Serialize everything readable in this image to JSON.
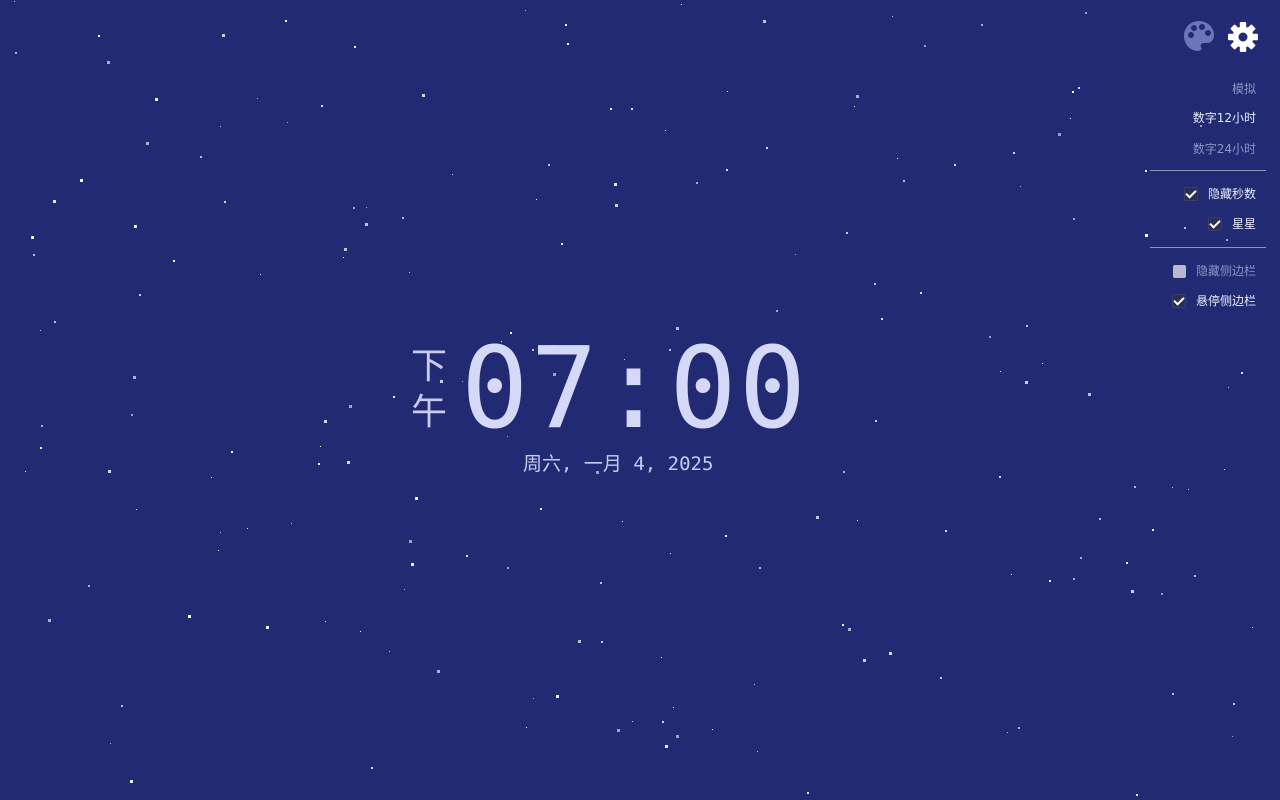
{
  "clock": {
    "period_top": "下",
    "period_bottom": "午",
    "time": "07:00",
    "date": "周六, 一月 4, 2025"
  },
  "top_icons": {
    "palette": "palette-icon",
    "settings": "gear-icon"
  },
  "menu": {
    "display_modes": [
      {
        "label": "模拟",
        "selected": false
      },
      {
        "label": "数字12小时",
        "selected": true
      },
      {
        "label": "数字24小时",
        "selected": false
      }
    ],
    "options_a": [
      {
        "label": "隐藏秒数",
        "checked": true
      },
      {
        "label": "星星",
        "checked": true
      }
    ],
    "options_b": [
      {
        "label": "隐藏侧边栏",
        "checked": false
      },
      {
        "label": "悬停侧边栏",
        "checked": true
      }
    ]
  },
  "colors": {
    "background": "#212a73",
    "clock_text": "#d6d8f7",
    "menu_active": "#e8e9fb",
    "menu_dim": "#8e93c4",
    "palette_icon": "#6e74b8",
    "gear_icon": "#ffffff"
  }
}
